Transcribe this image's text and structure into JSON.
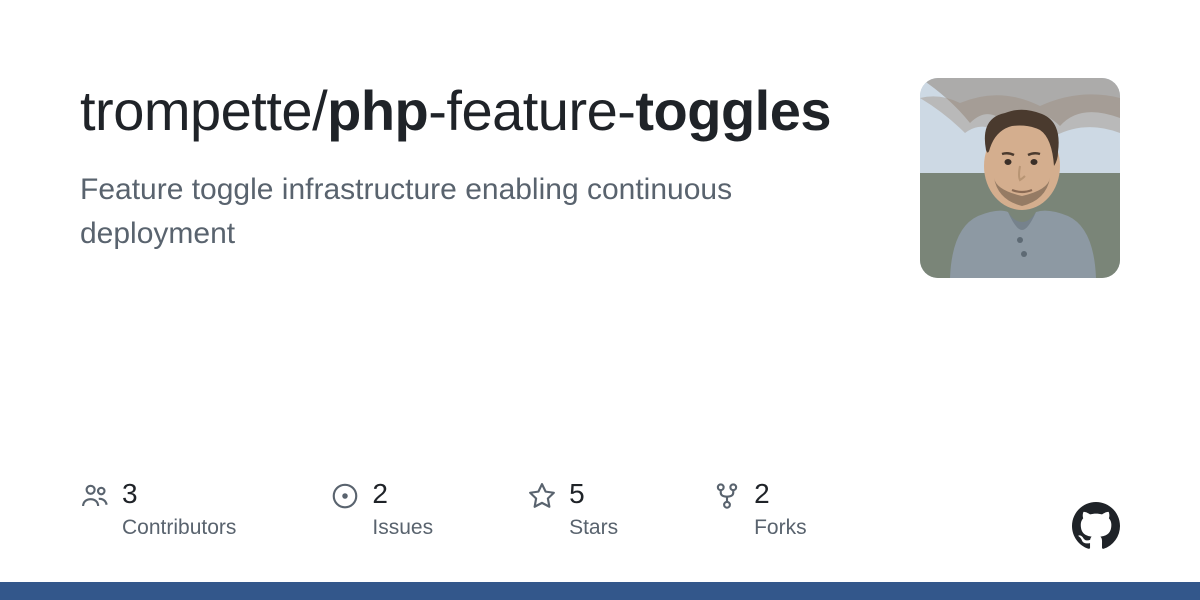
{
  "repo": {
    "owner": "trompette",
    "name_parts": {
      "bold1": "php",
      "mid": "-feature-",
      "bold2": "toggles"
    },
    "description": "Feature toggle infrastructure enabling continuous deployment"
  },
  "stats": {
    "contributors": {
      "count": "3",
      "label": "Contributors"
    },
    "issues": {
      "count": "2",
      "label": "Issues"
    },
    "stars": {
      "count": "5",
      "label": "Stars"
    },
    "forks": {
      "count": "2",
      "label": "Forks"
    }
  }
}
